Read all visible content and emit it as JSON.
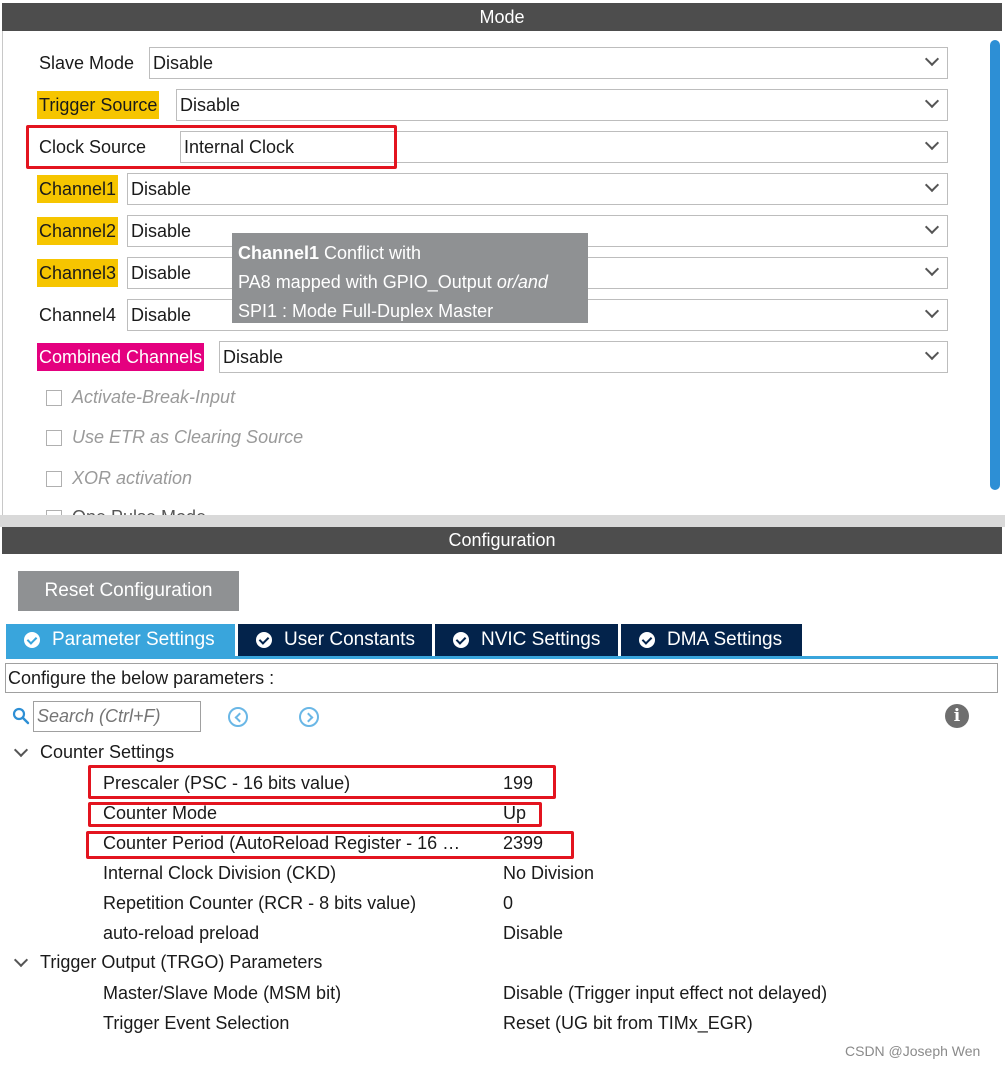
{
  "mode": {
    "header": "Mode",
    "rows": [
      {
        "label": "Slave Mode",
        "value": "Disable"
      },
      {
        "label": "Trigger Source",
        "value": "Disable"
      },
      {
        "label": "Clock Source",
        "value": "Internal Clock"
      },
      {
        "label": "Channel1",
        "value": "Disable"
      },
      {
        "label": "Channel2",
        "value": "Disable"
      },
      {
        "label": "Channel3",
        "value": "Disable"
      },
      {
        "label": "Channel4",
        "value": "Disable"
      },
      {
        "label": "Combined Channels",
        "value": "Disable"
      }
    ],
    "checkboxes": [
      "Activate-Break-Input",
      "Use ETR as Clearing Source",
      "XOR activation",
      "One Pulse Mode"
    ],
    "tooltip": {
      "line1_bold": "Channel1",
      "line1_rest": " Conflict with",
      "line2_main": "PA8 mapped with GPIO_Output ",
      "line2_italic": "or/and",
      "line3": "SPI1 : Mode Full-Duplex Master"
    },
    "highlight_colors": {
      "conflict": "#f6c500",
      "error": "#e4007f"
    }
  },
  "configuration": {
    "header": "Configuration",
    "reset_button": "Reset Configuration",
    "tabs": [
      "Parameter Settings",
      "User Constants",
      "NVIC Settings",
      "DMA Settings"
    ],
    "active_tab": "Parameter Settings",
    "description": "Configure the below parameters :",
    "search": {
      "placeholder": "Search (Ctrl+F)"
    },
    "groups": [
      {
        "title": "Counter Settings",
        "params": [
          {
            "name": "Prescaler (PSC - 16 bits value)",
            "value": "199"
          },
          {
            "name": "Counter Mode",
            "value": "Up"
          },
          {
            "name": "Counter Period (AutoReload Register - 16 …",
            "value": "2399"
          },
          {
            "name": "Internal Clock Division (CKD)",
            "value": "No Division"
          },
          {
            "name": "Repetition Counter (RCR - 8 bits value)",
            "value": "0"
          },
          {
            "name": "auto-reload preload",
            "value": "Disable"
          }
        ]
      },
      {
        "title": "Trigger Output (TRGO) Parameters",
        "params": [
          {
            "name": "Master/Slave Mode (MSM bit)",
            "value": "Disable (Trigger input effect not delayed)"
          },
          {
            "name": "Trigger Event Selection",
            "value": "Reset (UG bit from TIMx_EGR)"
          }
        ]
      }
    ],
    "colors": {
      "active_tab": "#39a5dc",
      "tab": "#03234b",
      "annotation": "#e3141f"
    }
  },
  "watermark": "CSDN @Joseph Wen"
}
